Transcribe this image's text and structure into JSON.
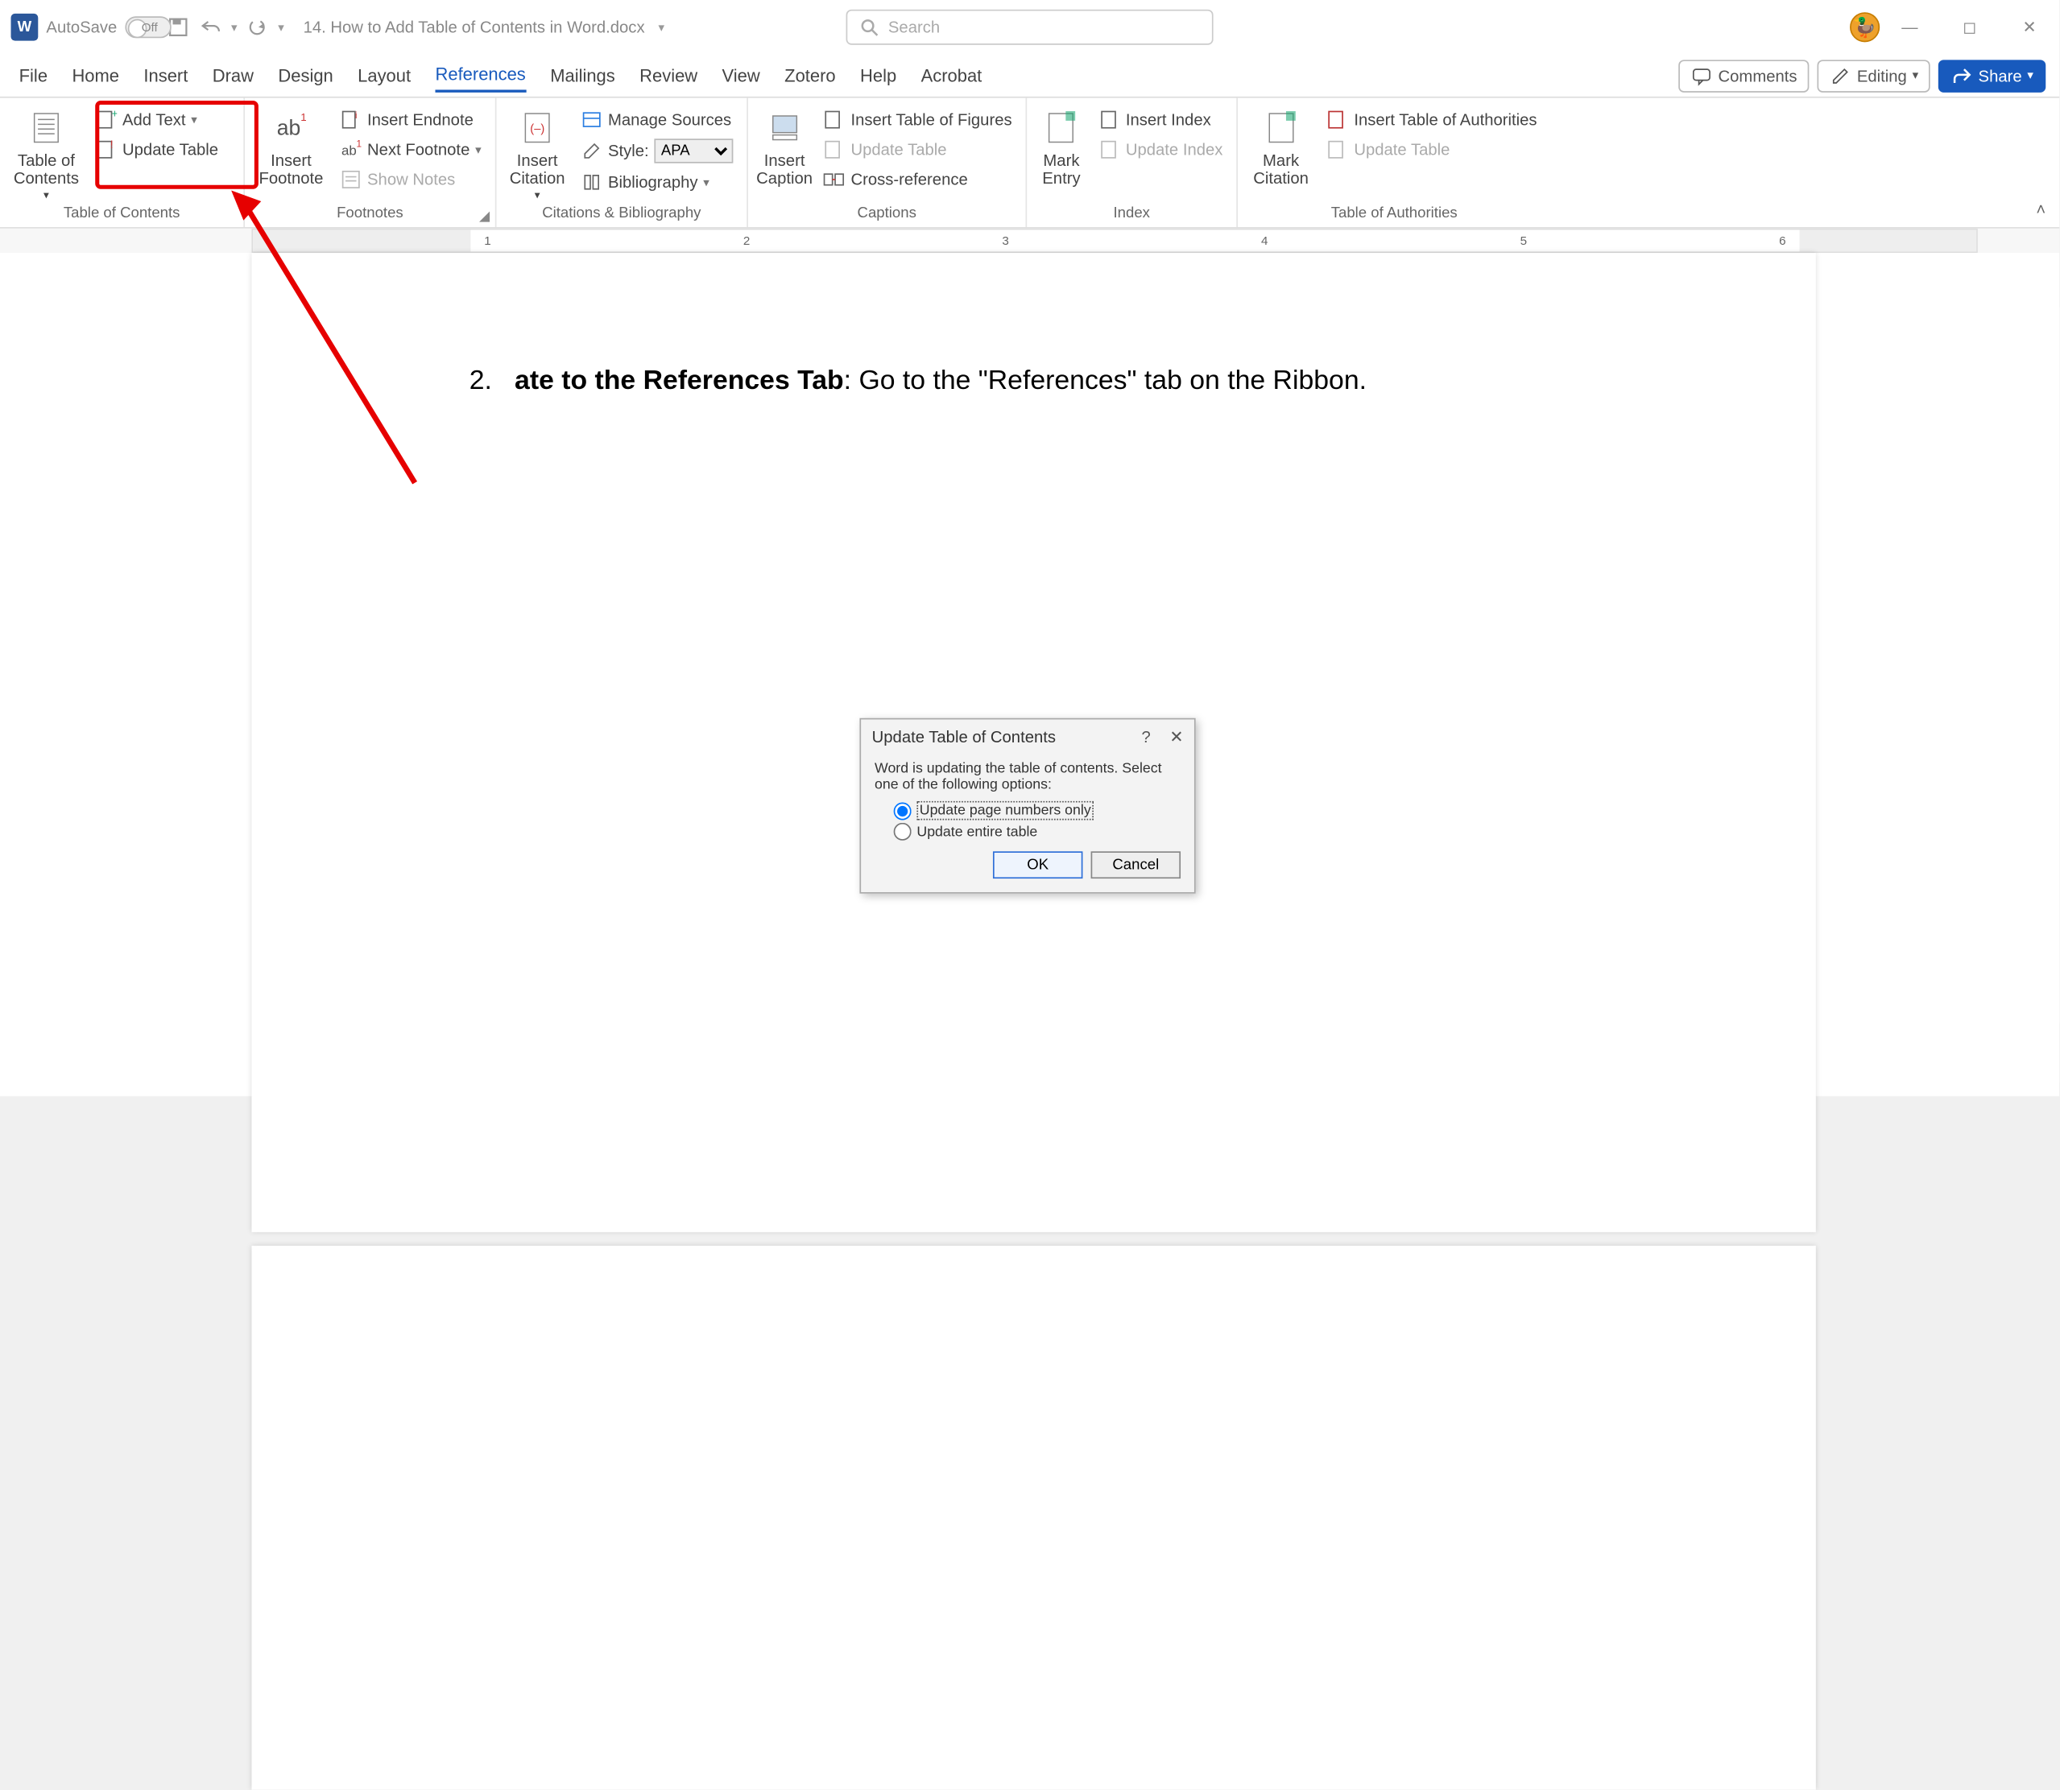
{
  "titlebar": {
    "autosave_label": "AutoSave",
    "autosave_state": "Off",
    "doc_title": "14. How to Add Table of Contents in Word.docx",
    "search_placeholder": "Search"
  },
  "tabs": {
    "file": "File",
    "home": "Home",
    "insert": "Insert",
    "draw": "Draw",
    "design": "Design",
    "layout": "Layout",
    "references": "References",
    "mailings": "Mailings",
    "review": "Review",
    "view": "View",
    "zotero": "Zotero",
    "help": "Help",
    "acrobat": "Acrobat"
  },
  "tabs_right": {
    "comments": "Comments",
    "editing": "Editing",
    "share": "Share"
  },
  "ribbon": {
    "toc": {
      "table_of_contents": "Table of Contents",
      "add_text": "Add Text",
      "update_table": "Update Table",
      "group_label": "Table of Contents"
    },
    "footnotes": {
      "insert_footnote": "Insert Footnote",
      "insert_endnote": "Insert Endnote",
      "next_footnote": "Next Footnote",
      "show_notes": "Show Notes",
      "group_label": "Footnotes"
    },
    "citations": {
      "insert_citation": "Insert Citation",
      "manage_sources": "Manage Sources",
      "style_label": "Style:",
      "style_value": "APA",
      "bibliography": "Bibliography",
      "group_label": "Citations & Bibliography"
    },
    "captions": {
      "insert_caption": "Insert Caption",
      "insert_tof": "Insert Table of Figures",
      "update_table": "Update Table",
      "cross_reference": "Cross-reference",
      "group_label": "Captions"
    },
    "index": {
      "mark_entry": "Mark Entry",
      "insert_index": "Insert Index",
      "update_index": "Update Index",
      "group_label": "Index"
    },
    "toa": {
      "mark_citation": "Mark Citation",
      "insert_toa": "Insert Table of Authorities",
      "update_table": "Update Table",
      "group_label": "Table of Authorities"
    }
  },
  "document": {
    "list_number": "2.",
    "line_bold": "ate to the References Tab",
    "line_rest": ": Go to the \"References\" tab on the Ribbon."
  },
  "dialog": {
    "title": "Update Table of Contents",
    "help": "?",
    "close": "✕",
    "message": "Word is updating the table of contents.  Select one of the following options:",
    "opt_pages": "Update page numbers only",
    "opt_entire": "Update entire table",
    "ok": "OK",
    "cancel": "Cancel"
  },
  "ruler_marks": [
    "1",
    "2",
    "3",
    "4",
    "5",
    "6"
  ]
}
